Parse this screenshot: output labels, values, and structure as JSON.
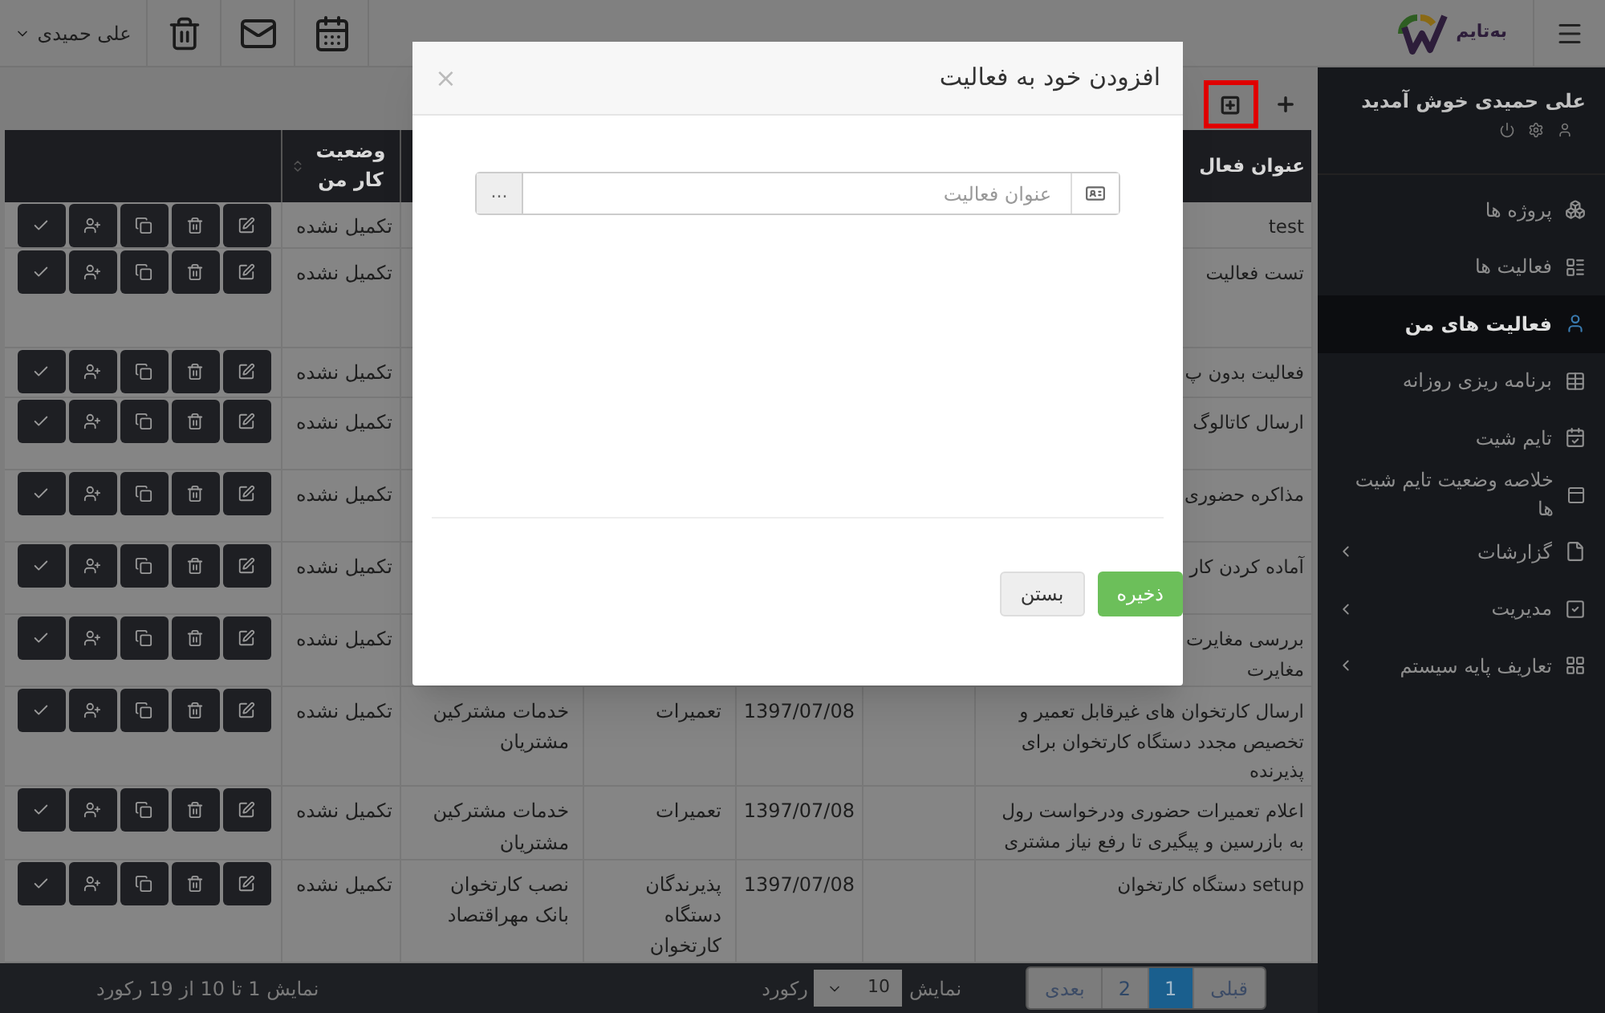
{
  "topbar": {
    "brand": "به‌تایم",
    "user_menu": "علی حمیدی"
  },
  "sidebar": {
    "welcome": "علی حمیدی خوش آمدید",
    "items": [
      {
        "label": "پروژه ها",
        "kind": "projects",
        "selected": false,
        "has_submenu": false
      },
      {
        "label": "فعالیت ها",
        "kind": "list",
        "selected": false,
        "has_submenu": false
      },
      {
        "label": "فعالیت های من",
        "kind": "person",
        "selected": true,
        "has_submenu": false
      },
      {
        "label": "برنامه ریزی روزانه",
        "kind": "table",
        "selected": false,
        "has_submenu": false
      },
      {
        "label": "تایم شیت",
        "kind": "calendar",
        "selected": false,
        "has_submenu": false
      },
      {
        "label": "خلاصه وضعیت تایم شیت ها",
        "kind": "summary",
        "selected": false,
        "has_submenu": false
      },
      {
        "label": "گزارشات",
        "kind": "file",
        "selected": false,
        "has_submenu": true
      },
      {
        "label": "مدیریت",
        "kind": "check",
        "selected": false,
        "has_submenu": true
      },
      {
        "label": "تعاریف پایه سیستم",
        "kind": "grid",
        "selected": false,
        "has_submenu": true
      }
    ]
  },
  "toolbar": {
    "add_button_highlighted": true
  },
  "table": {
    "title_header": "عنوان فعال",
    "status_header": "وضعیت کار من",
    "rows": [
      {
        "title": "test",
        "status": "تکمیل نشده"
      },
      {
        "title": "تست فعالیت",
        "status": "تکمیل نشده"
      },
      {
        "title": "فعالیت بدون پ",
        "status": "تکمیل نشده"
      },
      {
        "title": "ارسال کاتالوگ",
        "status": "تکمیل نشده"
      },
      {
        "title": "مذاکره حضوری",
        "status": "تکمیل نشده"
      },
      {
        "title": "آماده کردن کار",
        "status": "تکمیل نشده"
      },
      {
        "title": "بررسی مغایرت\nمغایرت",
        "status": "تکمیل نشده"
      },
      {
        "title": "ارسال کارتخوان های غیرقابل تعمیر و تخصیص مجدد دستگاه کارتخوان برای پذیرنده",
        "date": "1397/07/08",
        "category": "تعمیرات",
        "project": "خدمات مشترکین مشتریان",
        "status": "تکمیل نشده"
      },
      {
        "title": "اعلام تعمیرات حضوری ودرخواست رول به بازرسین و پیگیری تا رفع نیاز مشتری",
        "date": "1397/07/08",
        "category": "تعمیرات",
        "project": "خدمات مشترکین مشتریان",
        "status": "تکمیل نشده"
      },
      {
        "title": "setup دستگاه کارتخوان",
        "date": "1397/07/08",
        "category": "پذیرندگان دستگاه کارتخوان",
        "project": "نصب کارتخوان بانک مهراقتصاد",
        "status": "تکمیل نشده"
      }
    ]
  },
  "footer": {
    "pages": [
      {
        "label": "قبلی",
        "kind": "nav",
        "selected": false
      },
      {
        "label": "1",
        "kind": "page",
        "selected": true
      },
      {
        "label": "2",
        "kind": "page",
        "selected": false
      },
      {
        "label": "بعدی",
        "kind": "nav",
        "selected": false
      }
    ],
    "show_label": "نمایش",
    "page_size": "10",
    "records_label": "رکورد",
    "summary": "نمایش 1 تا 10 از 19 رکورد"
  },
  "modal": {
    "title": "افزودن خود به فعالیت",
    "close": "×",
    "field": {
      "placeholder": "عنوان فعالیت",
      "button": "..."
    },
    "buttons": [
      {
        "label": "ذخیره",
        "kind": "primary"
      },
      {
        "label": "بستن",
        "kind": "default"
      }
    ]
  }
}
